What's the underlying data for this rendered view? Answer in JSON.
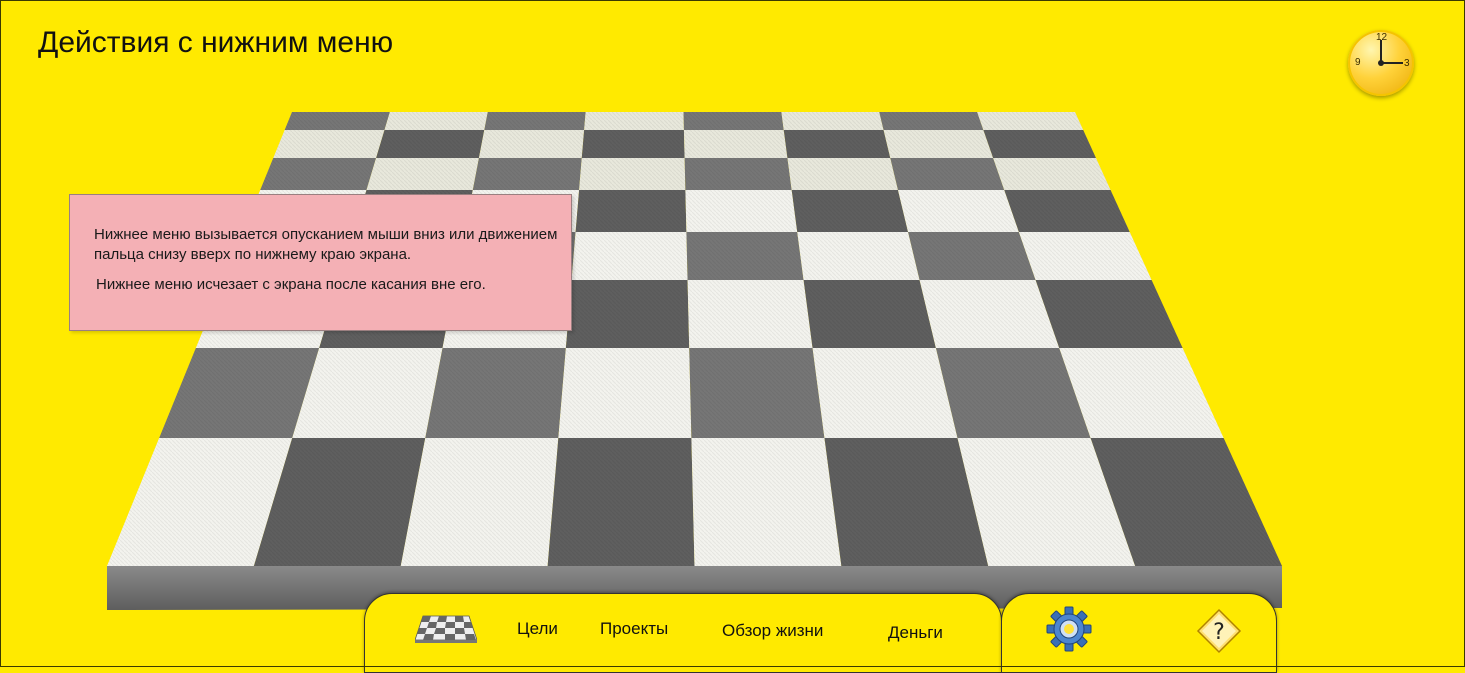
{
  "header": {
    "title": "Действия с нижним меню"
  },
  "clock": {
    "numbers": [
      "12",
      "9",
      "3"
    ],
    "icon": "clock-icon"
  },
  "info": {
    "line1": "Нижнее меню вызывается опусканием мыши вниз или движением пальца снизу вверх по нижнему краю экрана.",
    "line2": "Нижнее меню исчезает с экрана после касания вне его."
  },
  "bottom_menu": {
    "board_icon": "checkerboard-icon",
    "items": [
      "Цели",
      "Проекты",
      "Обзор жизни",
      "Деньги"
    ],
    "settings_icon": "gear-icon",
    "help_icon": "help-icon",
    "help_glyph": "?"
  },
  "colors": {
    "background": "#ffea00",
    "info_box": "#f4b0b5",
    "board_dark": "#6e6e6e",
    "board_light": "#f3f3ee"
  }
}
